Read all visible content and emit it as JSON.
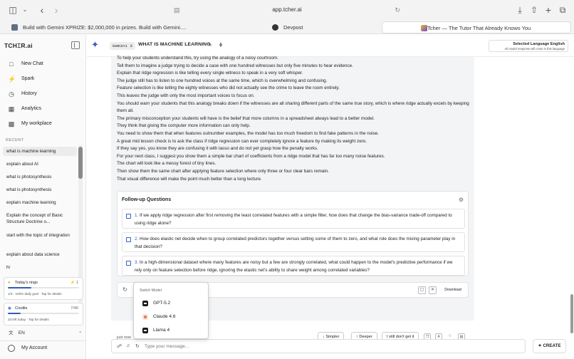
{
  "browser": {
    "url": "app.tcher.ai",
    "tabs": [
      {
        "label": "Build with Gemini XPRIZE: $2,000,000 in prizes. Build with Gemini...."
      },
      {
        "label": "Devpost"
      },
      {
        "label": "Tcher — The Tutor That Already Knows You"
      }
    ]
  },
  "sidebar": {
    "logo": "TCH⌶R.ai",
    "nav": [
      {
        "label": "New Chat",
        "icon": "chat-bubble-icon"
      },
      {
        "label": "Spark",
        "icon": "lightning-icon"
      },
      {
        "label": "History",
        "icon": "clock-icon"
      },
      {
        "label": "Analytics",
        "icon": "grid-icon"
      },
      {
        "label": "My workplace",
        "icon": "briefcase-icon"
      }
    ],
    "recent_header": "RECENT",
    "recent": [
      "what is machine learning",
      "explain about AI",
      "what is photosynthesis",
      "what is photosynthesis",
      "explain machine learning",
      "Explain the concept of Basic Structure Doctrine o...",
      "start with the topic of integration",
      "explain about data science",
      "hi"
    ],
    "rings": {
      "title": "Today's rings",
      "count": "1",
      "subtitle": "1/3 · 100% daily goal · Tap for details",
      "progress": 0.33
    },
    "credits": {
      "title": "Credits",
      "value": "7/40",
      "subtitle": "33 left today · Tap for details",
      "progress": 0.175
    },
    "language": "EN",
    "account": "My Account"
  },
  "header": {
    "model": "Gemini 3",
    "title": "WHAT IS MACHINE LEARNING",
    "lang_title": "Selected Language English",
    "lang_sub": "All model response will come in this language"
  },
  "body_lines": [
    "To help your students understand this, try using the analogy of a noisy courtroom.",
    "Tell them to imagine a judge trying to decide a case with one hundred witnesses but only five minutes to hear evidence.",
    "Explain that ridge regression is like telling every single witness to speak in a very soft whisper.",
    "The judge still has to listen to one hundred voices at the same time, which is overwhelming and confusing.",
    "Feature selection is like telling the eighty witnesses who did not actually see the crime to leave the room entirely.",
    "This leaves the judge with only the most important voices to focus on.",
    "You should warn your students that this analogy breaks down if the witnesses are all sharing different parts of the same true story, which is where ridge actually excels by keeping them all.",
    "The primary misconception your students will have is the belief that more columns in a spreadsheet always lead to a better model.",
    "They think that giving the computer more information can only help.",
    "You need to show them that when features outnumber examples, the model has too much freedom to find fake patterns in the noise.",
    "A great mid lesson check is to ask the class if ridge regression can ever completely ignore a feature by making its weight zero.",
    "If they say yes, you know they are confusing it with lasso and do not yet grasp how the penalty works.",
    "For your next class, I suggest you show them a simple bar chart of coefficients from a ridge model that has far too many noise features.",
    "The chart will look like a messy forest of tiny lines.",
    "Then show them the same chart after applying feature selection where only three or four clear bars remain.",
    "That visual difference will make the point much better than a long lecture."
  ],
  "followups": {
    "title": "Follow-up Questions",
    "items": [
      {
        "num": "1.",
        "text": "If we apply ridge regression after first removing the least correlated features with a simple filter, how does that change the bias-variance trade-off compared to using ridge alone?"
      },
      {
        "num": "2.",
        "text": "How does elastic net decide when to group correlated predictors together versus setting some of them to zero, and what role does the mixing parameter play in that decision?"
      },
      {
        "num": "3.",
        "text": "In a high-dimensional dataset where many features are noisy but a few are strongly correlated, what could happen to the model's predictive performance if we rely only on feature selection before ridge, ignoring the elastic net's ability to share weight among correlated variables?"
      }
    ]
  },
  "actions": {
    "download": "Download",
    "timestamp": "just now",
    "simpler": "↓ Simpler",
    "deeper": "↑ Deeper",
    "dont_get": "I still don't get it"
  },
  "model_menu": {
    "title": "Switch Model",
    "options": [
      "GPT-5.2",
      "Claude 4.6",
      "Llama 4"
    ]
  },
  "composer": {
    "placeholder": "Type your message...",
    "create": "CREATE"
  }
}
